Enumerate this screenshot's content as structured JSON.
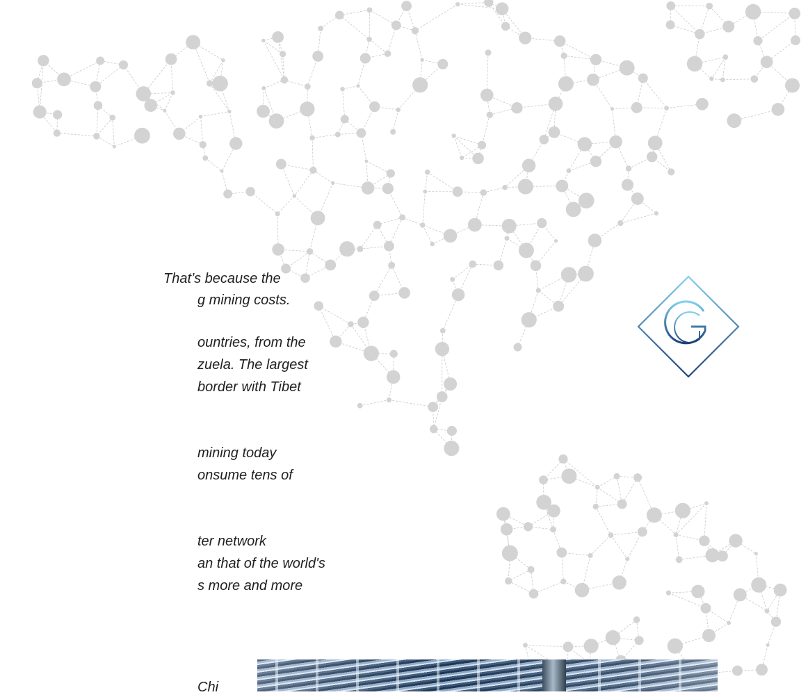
{
  "text_lines": [
    "That’s because the",
    "g mining costs.",
    "ountries, from the",
    "zuela. The largest",
    "border with Tibet",
    "mining today",
    "onsume tens of",
    "ter network",
    "an that of the world's",
    "s more and more",
    "Chi"
  ],
  "logo": {
    "icon": "euro-g-diamond-logo",
    "colors": {
      "gradient_top": "#7fd0ec",
      "gradient_bottom": "#1c3f7a"
    }
  },
  "map": {
    "icon": "americas-network-map",
    "colors": {
      "node": "#d3d3d3",
      "line": "#c8c8c8"
    }
  },
  "photo": {
    "icon": "server-farm-photo"
  }
}
